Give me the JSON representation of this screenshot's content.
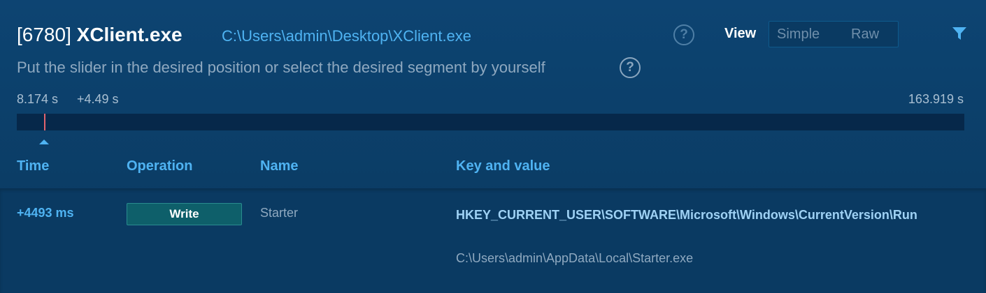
{
  "process": {
    "pid_label": "[6780]",
    "name": "XClient.exe",
    "path": "C:\\Users\\admin\\Desktop\\XClient.exe"
  },
  "icons": {
    "help": "question-circle-icon",
    "filter": "filter-icon",
    "help_glyph": "?"
  },
  "view": {
    "label": "View",
    "options": [
      "Simple",
      "Raw"
    ]
  },
  "subtitle": "Put the slider in the desired position or select the desired segment by yourself",
  "timeline": {
    "start": "8.174 s",
    "offset": "+4.49 s",
    "end": "163.919 s"
  },
  "table": {
    "columns": [
      "Time",
      "Operation",
      "Name",
      "Key and value"
    ],
    "rows": [
      {
        "time": "+4493 ms",
        "operation": "Write",
        "name": "Starter",
        "key": "HKEY_CURRENT_USER\\SOFTWARE\\Microsoft\\Windows\\CurrentVersion\\Run",
        "value": "C:\\Users\\admin\\AppData\\Local\\Starter.exe"
      }
    ]
  },
  "colors": {
    "background": "#0b3d66",
    "accent": "#4fb3f2",
    "marker": "#e2646e",
    "badge": "#0e5f6a"
  }
}
